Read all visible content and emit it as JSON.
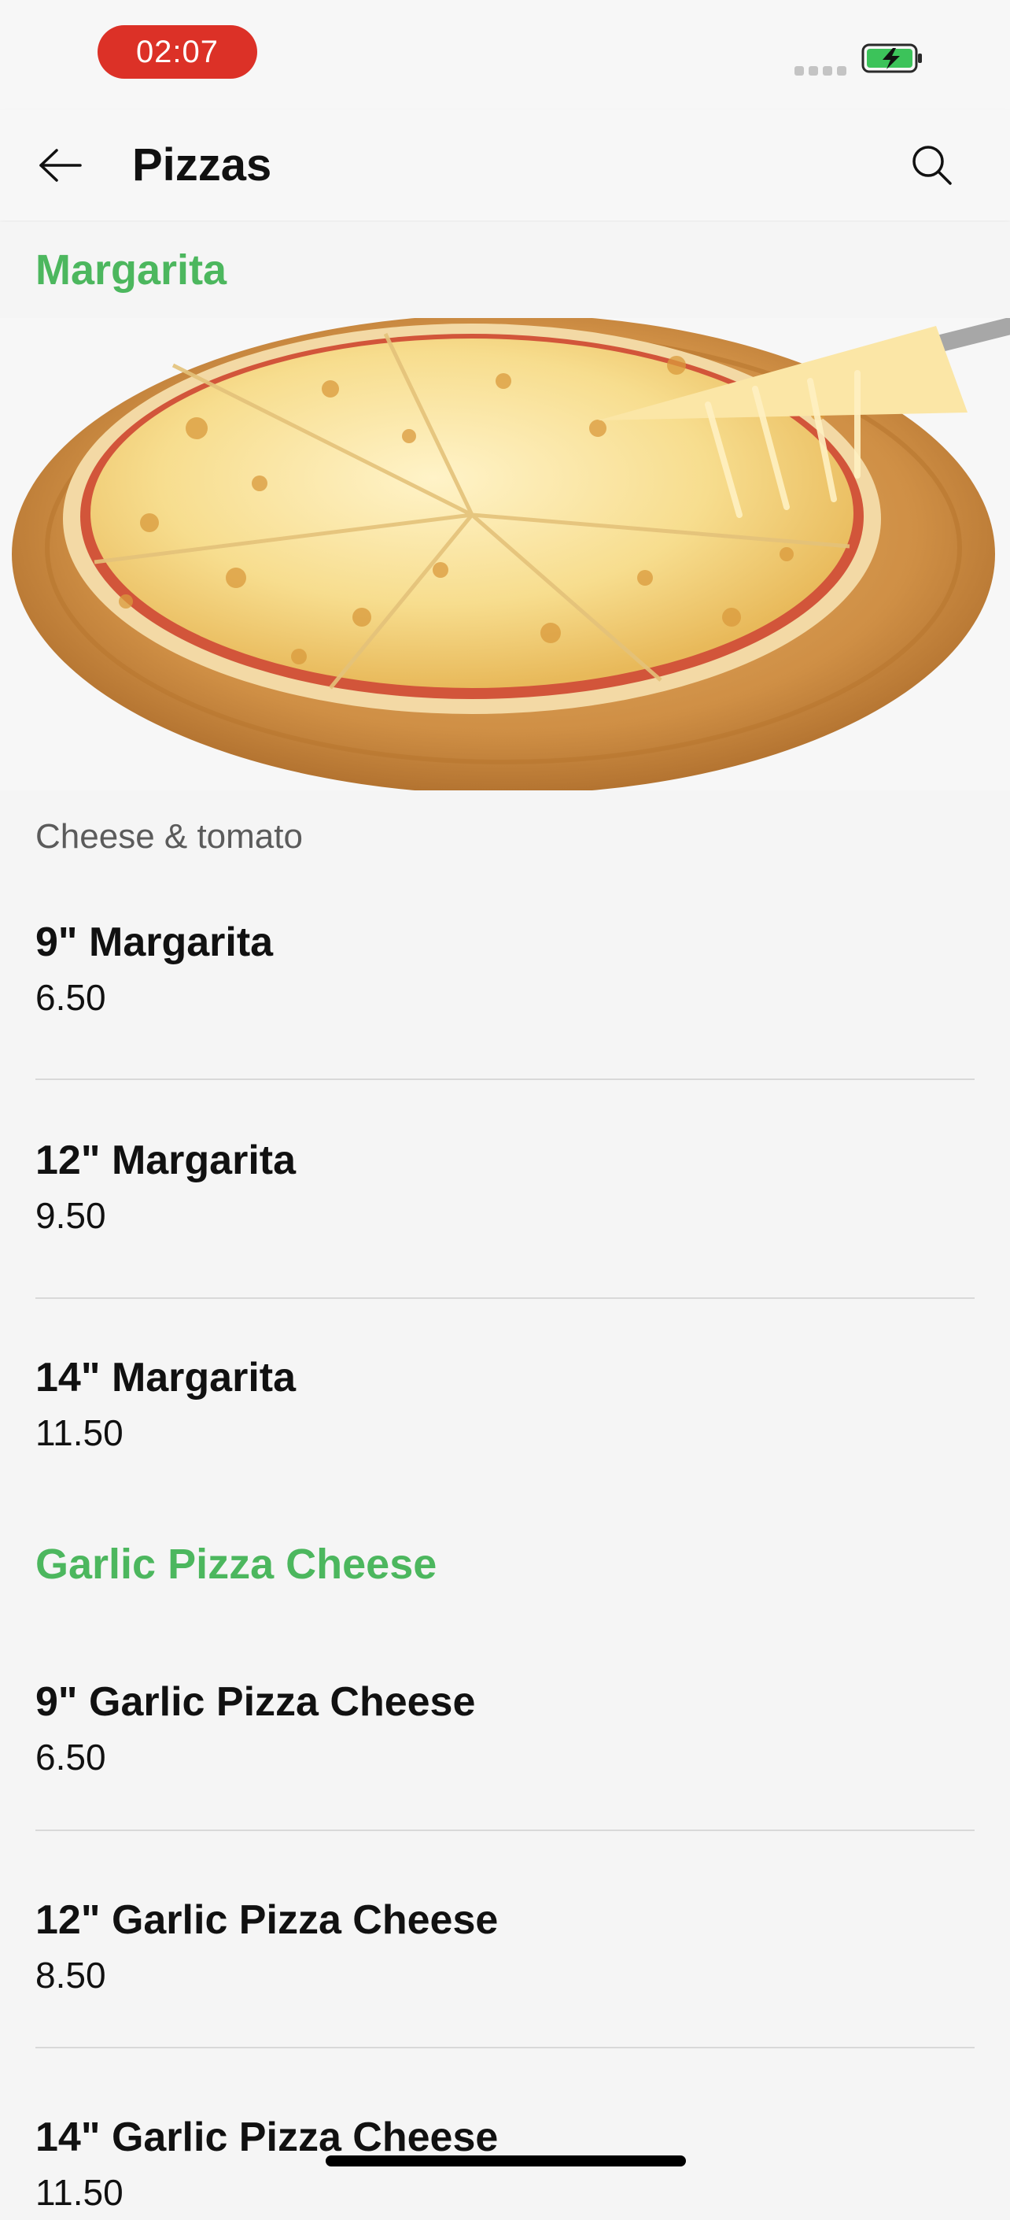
{
  "status_bar": {
    "time": "02:07",
    "colors": {
      "time_pill": "#dc3127",
      "battery": "#3cc35a"
    },
    "icons": [
      "signal-dots-icon",
      "battery-charging-icon"
    ]
  },
  "header": {
    "title": "Pizzas",
    "back_icon": "arrow-left-icon",
    "search_icon": "search-icon"
  },
  "accent_color": "#4cb75e",
  "sections": [
    {
      "title": "Margarita",
      "image": "margarita-pizza-photo",
      "description": "Cheese & tomato",
      "items": [
        {
          "name": "9\" Margarita",
          "price": "6.50"
        },
        {
          "name": "12\" Margarita",
          "price": "9.50"
        },
        {
          "name": "14\" Margarita",
          "price": "11.50"
        }
      ]
    },
    {
      "title": "Garlic Pizza Cheese",
      "items": [
        {
          "name": "9\" Garlic Pizza Cheese",
          "price": "6.50"
        },
        {
          "name": "12\" Garlic Pizza Cheese",
          "price": "8.50"
        },
        {
          "name": "14\" Garlic Pizza Cheese",
          "price": "11.50"
        }
      ]
    }
  ]
}
